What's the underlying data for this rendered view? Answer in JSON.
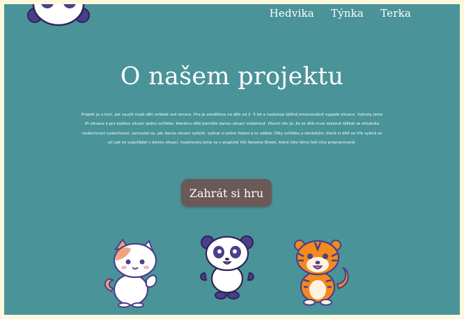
{
  "nav": {
    "items": [
      {
        "label": "Hedvika"
      },
      {
        "label": "Týnka"
      },
      {
        "label": "Terka"
      }
    ]
  },
  "hero": {
    "title": "O našem projektu",
    "description": "Projekt je o tom, jak naučit malé děti zvládat své emoce. Hra je zaměřena na děti od 2- 5 let a nastoluje běžné emocionálně vypjaté situace. Vybraly jsme tři situace a pro každou situaci jedno zvířátko, kterému dítě pomůže danou situaci zvládnout. Hlavní věc je, že se dítě musí zastavit těžkat se zhluboka nadechnout vydechnout, zamyslet se, jak danou situaci vyřešit, vybrat si jedno řešení a to udělat. Díky zvířátku a obrázkům, které si dítě ve hře vybírá se učí jak se vypořádat s danou situací. Inspirovaly jsme se v anglické hře Sesame Street, která toto téma řeší více propracovaně.",
    "play_label": "Zahrát si hru"
  },
  "colors": {
    "page_bg": "#fdf8dd",
    "content_bg": "#4a9399",
    "button_bg": "#6b5957",
    "text": "#ffffff"
  },
  "icons": {
    "logo": "panda-logo-icon",
    "characters": [
      "cat-character-icon",
      "panda-character-icon",
      "tiger-character-icon"
    ]
  }
}
